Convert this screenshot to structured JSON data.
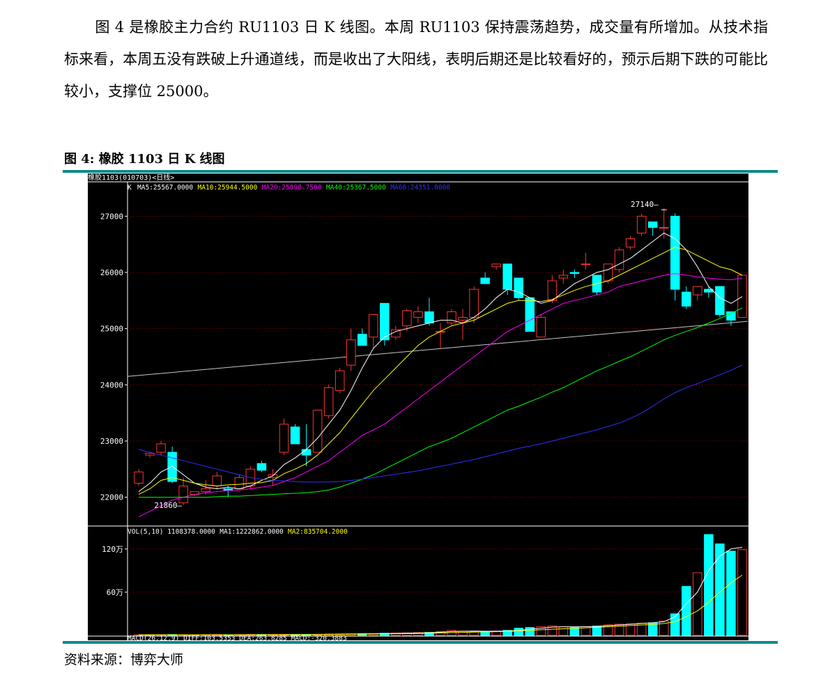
{
  "text": {
    "paragraph": "图 4 是橡胶主力合约 RU1103 日 K 线图。本周 RU1103 保持震荡趋势，成交量有所增加。从技术指标来看，本周五没有跌破上升通道线，而是收出了大阳线，表明后期还是比较看好的，预示后期下跌的可能比较小，支撑位 25000。",
    "figure_title": "图 4:  橡胶 1103 日 K 线图",
    "source": "资料来源：博弈大师"
  },
  "colors": {
    "background": "#000000",
    "up": "#ff3232",
    "down": "#00ffff",
    "ma5": "#ffffff",
    "ma10": "#ffff00",
    "ma20": "#ff00ff",
    "ma40": "#00ff00",
    "ma60": "#3030ff",
    "grid": "#a00000",
    "axis": "#ffffff",
    "rule": "#0d8a8a"
  },
  "chart_data": {
    "type": "candlestick",
    "title": "橡胶1103(010703)<日线>",
    "indicator_line": {
      "prefix": "K",
      "items": [
        {
          "label": "MA5:25567.0000",
          "color": "#ffffff"
        },
        {
          "label": "MA10:25944.5000",
          "color": "#ffff00"
        },
        {
          "label": "MA20:25898.7500",
          "color": "#ff00ff"
        },
        {
          "label": "MA40:25367.5000",
          "color": "#00ff00"
        },
        {
          "label": "MA60:24351.0000",
          "color": "#3030ff"
        }
      ]
    },
    "price_axis": {
      "ylim": [
        21500,
        27500
      ],
      "ticks": [
        22000,
        23000,
        24000,
        25000,
        26000,
        27000
      ],
      "tick_labels": [
        "22000",
        "23000",
        "24000",
        "25000",
        "26000",
        "27000"
      ]
    },
    "annotations": {
      "high": "27140",
      "low": "21860",
      "high_value": 27140,
      "low_value": 21860
    },
    "candles": [
      {
        "o": 22250,
        "h": 22500,
        "l": 22200,
        "c": 22450
      },
      {
        "o": 22750,
        "h": 22800,
        "l": 22700,
        "c": 22780
      },
      {
        "o": 22800,
        "h": 23000,
        "l": 22750,
        "c": 22950
      },
      {
        "o": 22800,
        "h": 22900,
        "l": 22250,
        "c": 22280
      },
      {
        "o": 21900,
        "h": 22350,
        "l": 21860,
        "c": 22200
      },
      {
        "o": 22050,
        "h": 22100,
        "l": 22020,
        "c": 22100
      },
      {
        "o": 22100,
        "h": 22300,
        "l": 22050,
        "c": 22150
      },
      {
        "o": 22200,
        "h": 22450,
        "l": 22150,
        "c": 22380
      },
      {
        "o": 22150,
        "h": 22200,
        "l": 22000,
        "c": 22120
      },
      {
        "o": 22150,
        "h": 22400,
        "l": 22150,
        "c": 22350
      },
      {
        "o": 22200,
        "h": 22550,
        "l": 22150,
        "c": 22500
      },
      {
        "o": 22600,
        "h": 22650,
        "l": 22450,
        "c": 22480
      },
      {
        "o": 22350,
        "h": 22500,
        "l": 22200,
        "c": 22400
      },
      {
        "o": 22800,
        "h": 23400,
        "l": 22750,
        "c": 23300
      },
      {
        "o": 23250,
        "h": 23300,
        "l": 22950,
        "c": 22950
      },
      {
        "o": 22850,
        "h": 23300,
        "l": 22550,
        "c": 22750
      },
      {
        "o": 22800,
        "h": 23550,
        "l": 22800,
        "c": 23550
      },
      {
        "o": 23450,
        "h": 24000,
        "l": 23400,
        "c": 23950
      },
      {
        "o": 23900,
        "h": 24300,
        "l": 23850,
        "c": 24250
      },
      {
        "o": 24350,
        "h": 25000,
        "l": 24250,
        "c": 24800
      },
      {
        "o": 24900,
        "h": 25000,
        "l": 24700,
        "c": 24700
      },
      {
        "o": 24850,
        "h": 25250,
        "l": 24650,
        "c": 25250
      },
      {
        "o": 25450,
        "h": 25450,
        "l": 24700,
        "c": 24800
      },
      {
        "o": 24850,
        "h": 25050,
        "l": 24800,
        "c": 24980
      },
      {
        "o": 25050,
        "h": 25350,
        "l": 24950,
        "c": 25320
      },
      {
        "o": 25200,
        "h": 25400,
        "l": 25100,
        "c": 25300
      },
      {
        "o": 25300,
        "h": 25550,
        "l": 25050,
        "c": 25100
      },
      {
        "o": 24950,
        "h": 25100,
        "l": 24650,
        "c": 24950
      },
      {
        "o": 25100,
        "h": 25350,
        "l": 25050,
        "c": 25300
      },
      {
        "o": 25150,
        "h": 25350,
        "l": 24800,
        "c": 25200
      },
      {
        "o": 25200,
        "h": 25750,
        "l": 25100,
        "c": 25700
      },
      {
        "o": 25900,
        "h": 26000,
        "l": 25800,
        "c": 25800
      },
      {
        "o": 26100,
        "h": 26150,
        "l": 26050,
        "c": 26150
      },
      {
        "o": 26150,
        "h": 26150,
        "l": 25600,
        "c": 25700
      },
      {
        "o": 25900,
        "h": 25900,
        "l": 25500,
        "c": 25550
      },
      {
        "o": 25550,
        "h": 25550,
        "l": 24950,
        "c": 24950
      },
      {
        "o": 24850,
        "h": 25250,
        "l": 24850,
        "c": 25200
      },
      {
        "o": 25500,
        "h": 25950,
        "l": 25450,
        "c": 25850
      },
      {
        "o": 25900,
        "h": 26050,
        "l": 25800,
        "c": 25950
      },
      {
        "o": 26000,
        "h": 26050,
        "l": 25900,
        "c": 25980
      },
      {
        "o": 26150,
        "h": 26350,
        "l": 26050,
        "c": 26150
      },
      {
        "o": 25950,
        "h": 25950,
        "l": 25600,
        "c": 25650
      },
      {
        "o": 25850,
        "h": 26150,
        "l": 25800,
        "c": 26150
      },
      {
        "o": 26050,
        "h": 26450,
        "l": 26000,
        "c": 26400
      },
      {
        "o": 26450,
        "h": 26650,
        "l": 26400,
        "c": 26600
      },
      {
        "o": 26700,
        "h": 27050,
        "l": 26650,
        "c": 27000
      },
      {
        "o": 26900,
        "h": 26900,
        "l": 26650,
        "c": 26800
      },
      {
        "o": 26800,
        "h": 27140,
        "l": 26600,
        "c": 26800
      },
      {
        "o": 27000,
        "h": 27050,
        "l": 25500,
        "c": 25700
      },
      {
        "o": 25650,
        "h": 25750,
        "l": 25350,
        "c": 25400
      },
      {
        "o": 25600,
        "h": 25750,
        "l": 25500,
        "c": 25750
      },
      {
        "o": 25700,
        "h": 25750,
        "l": 25550,
        "c": 25650
      },
      {
        "o": 25750,
        "h": 25750,
        "l": 25200,
        "c": 25250
      },
      {
        "o": 25300,
        "h": 25300,
        "l": 25050,
        "c": 25150
      },
      {
        "o": 25200,
        "h": 25950,
        "l": 25200,
        "c": 25950
      }
    ],
    "channel_line": {
      "start": 24150,
      "end": 25130
    },
    "ma_lines": [
      {
        "name": "MA5",
        "color": "#ffffff",
        "values": [
          22100,
          22250,
          22450,
          22550,
          22400,
          22250,
          22180,
          22150,
          22180,
          22150,
          22200,
          22300,
          22380,
          22580,
          22700,
          22850,
          23050,
          23300,
          23550,
          23900,
          24300,
          24650,
          24850,
          24950,
          25000,
          25050,
          25100,
          25150,
          25150,
          25100,
          25200,
          25350,
          25550,
          25700,
          25650,
          25550,
          25450,
          25500,
          25650,
          25800,
          25900,
          26000,
          26050,
          26150,
          26250,
          26400,
          26550,
          26700,
          26600,
          26400,
          26100,
          25750,
          25550,
          25450,
          25570
        ]
      },
      {
        "name": "MA10",
        "color": "#ffff00",
        "values": [
          22050,
          22150,
          22300,
          22350,
          22300,
          22250,
          22220,
          22200,
          22220,
          22230,
          22250,
          22260,
          22300,
          22420,
          22500,
          22600,
          22750,
          22950,
          23150,
          23400,
          23650,
          23900,
          24100,
          24300,
          24500,
          24700,
          24850,
          24950,
          25050,
          25100,
          25150,
          25250,
          25350,
          25450,
          25500,
          25500,
          25480,
          25520,
          25600,
          25680,
          25750,
          25800,
          25850,
          25950,
          26050,
          26150,
          26250,
          26350,
          26450,
          26400,
          26300,
          26200,
          26100,
          26050,
          25950
        ]
      },
      {
        "name": "MA20",
        "color": "#ff00ff",
        "values": [
          21650,
          21750,
          21850,
          21950,
          22000,
          22050,
          22080,
          22100,
          22120,
          22130,
          22150,
          22180,
          22210,
          22280,
          22350,
          22450,
          22550,
          22650,
          22800,
          22950,
          23100,
          23200,
          23300,
          23450,
          23600,
          23750,
          23900,
          24050,
          24200,
          24350,
          24500,
          24650,
          24800,
          24950,
          25050,
          25150,
          25250,
          25350,
          25450,
          25500,
          25550,
          25600,
          25650,
          25750,
          25800,
          25850,
          25900,
          25950,
          25980,
          25950,
          25920,
          25900,
          25880,
          25870,
          25900
        ]
      },
      {
        "name": "MA40",
        "color": "#00ff00",
        "values": [
          22000,
          22000,
          22000,
          22000,
          22000,
          22000,
          22000,
          22010,
          22020,
          22020,
          22030,
          22040,
          22050,
          22060,
          22070,
          22080,
          22100,
          22130,
          22180,
          22250,
          22320,
          22400,
          22500,
          22600,
          22700,
          22800,
          22900,
          22970,
          23050,
          23150,
          23250,
          23350,
          23450,
          23550,
          23620,
          23700,
          23780,
          23870,
          23950,
          24050,
          24150,
          24250,
          24330,
          24420,
          24500,
          24600,
          24700,
          24800,
          24880,
          24950,
          25020,
          25100,
          25180,
          25270,
          25367
        ]
      },
      {
        "name": "MA60",
        "color": "#3030ff",
        "values": [
          22850,
          22800,
          22750,
          22700,
          22650,
          22600,
          22550,
          22500,
          22450,
          22400,
          22350,
          22320,
          22300,
          22290,
          22280,
          22270,
          22270,
          22270,
          22280,
          22300,
          22320,
          22350,
          22380,
          22410,
          22440,
          22470,
          22510,
          22550,
          22590,
          22630,
          22670,
          22720,
          22770,
          22820,
          22870,
          22910,
          22950,
          23000,
          23050,
          23100,
          23150,
          23200,
          23260,
          23320,
          23400,
          23500,
          23620,
          23750,
          23860,
          23950,
          24020,
          24100,
          24180,
          24260,
          24351
        ]
      }
    ],
    "volume_panel": {
      "label_prefix": "VOL(5,10)",
      "label_value": "1108378.0000",
      "ma1_label": "MA1:1222862.0000",
      "ma2_label": "MA2:835704.2000",
      "ylim": [
        0,
        1450000
      ],
      "ticks": [
        600000,
        1200000
      ],
      "tick_labels": [
        "60万",
        "120万"
      ],
      "values": [
        8000,
        10000,
        9000,
        12000,
        10000,
        9000,
        10000,
        11000,
        9000,
        10000,
        11000,
        12000,
        11000,
        13000,
        12000,
        14000,
        15000,
        18000,
        20000,
        22000,
        24000,
        26000,
        30000,
        32000,
        34000,
        38000,
        42000,
        55000,
        70000,
        60000,
        50000,
        55000,
        60000,
        70000,
        100000,
        110000,
        120000,
        130000,
        120000,
        110000,
        120000,
        130000,
        145000,
        155000,
        160000,
        170000,
        175000,
        200000,
        300000,
        680000,
        870000,
        1400000,
        1270000,
        1170000,
        1190000,
        1108378
      ],
      "ma1_values": [
        8000,
        9000,
        9500,
        10000,
        10000,
        10000,
        10000,
        10200,
        10000,
        10200,
        10500,
        11000,
        11000,
        11500,
        12000,
        12500,
        13500,
        15000,
        17000,
        19000,
        21000,
        23000,
        26000,
        28500,
        31000,
        34000,
        37000,
        44000,
        54000,
        58000,
        60000,
        58000,
        58000,
        60000,
        70000,
        85000,
        100000,
        115000,
        120000,
        120000,
        122000,
        125000,
        135000,
        145000,
        155000,
        165000,
        175000,
        190000,
        260000,
        440000,
        600000,
        900000,
        1100000,
        1200000,
        1222862
      ],
      "ma2_values": [
        8000,
        8500,
        9000,
        9500,
        10000,
        10000,
        10000,
        10000,
        10000,
        10000,
        10200,
        10500,
        10700,
        11000,
        11300,
        11700,
        12300,
        13200,
        14500,
        16000,
        17500,
        19000,
        21000,
        23000,
        25000,
        27500,
        30000,
        34000,
        39000,
        43000,
        46000,
        49000,
        52000,
        56000,
        62000,
        70000,
        78000,
        86000,
        92000,
        98000,
        105000,
        112000,
        120000,
        128000,
        136000,
        145000,
        153000,
        165000,
        190000,
        260000,
        340000,
        460000,
        600000,
        730000,
        835704
      ]
    },
    "macd_label_visible": "MACD(26,12,9) DIFF:103.5353  DEA:263.8285  MACD:-320.3883"
  }
}
